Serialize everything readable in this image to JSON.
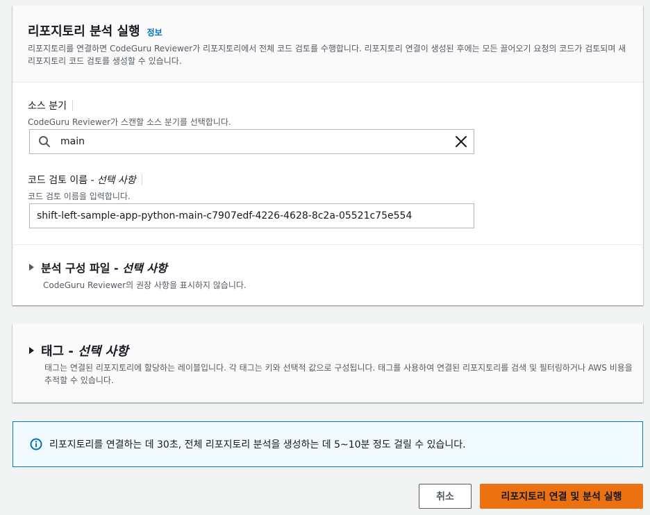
{
  "section": {
    "title": "리포지토리 분석 실행",
    "info_link": "정보",
    "description": "리포지토리를 연결하면 CodeGuru Reviewer가 리포지토리에서 전체 코드 검토를 수행합니다. 리포지토리 연결이 생성된 후에는 모든 끌어오기 요청의 코드가 검토되며 새 리포지토리 코드 검토를 생성할 수 있습니다."
  },
  "source_branch": {
    "label": "소스 분기",
    "description": "CodeGuru Reviewer가 스캔할 소스 분기를 선택합니다.",
    "value": "main",
    "icon": "search-icon",
    "clear_icon": "close-icon"
  },
  "code_review_name": {
    "label": "코드 검토 이름 -",
    "label_optional": "선택 사항",
    "description": "코드 검토 이름을 입력합니다.",
    "value": "shift-left-sample-app-python-main-c7907edf-4226-4628-8c2a-05521c75e554"
  },
  "analysis_config": {
    "title": "분석 구성 파일 -",
    "title_optional": "선택 사항",
    "description": "CodeGuru Reviewer의 권장 사항을 표시하지 않습니다."
  },
  "tags": {
    "title": "태그 -",
    "title_optional": "선택 사항",
    "description": "태그는 연결된 리포지토리에 할당하는 레이블입니다. 각 태그는 키와 선택적 값으로 구성됩니다. 태그를 사용하여 연결된 리포지토리를 검색 및 필터링하거나 AWS 비용을 추적할 수 있습니다."
  },
  "alert": {
    "icon": "info-icon",
    "text": "리포지토리를 연결하는 데 30초, 전체 리포지토리 분석을 생성하는 데 5~10분 정도 걸릴 수 있습니다."
  },
  "actions": {
    "cancel_label": "취소",
    "submit_label": "리포지토리 연결 및 분석 실행"
  },
  "colors": {
    "primary": "#ec7211",
    "link": "#0073bb",
    "info_background": "#f1faff"
  }
}
